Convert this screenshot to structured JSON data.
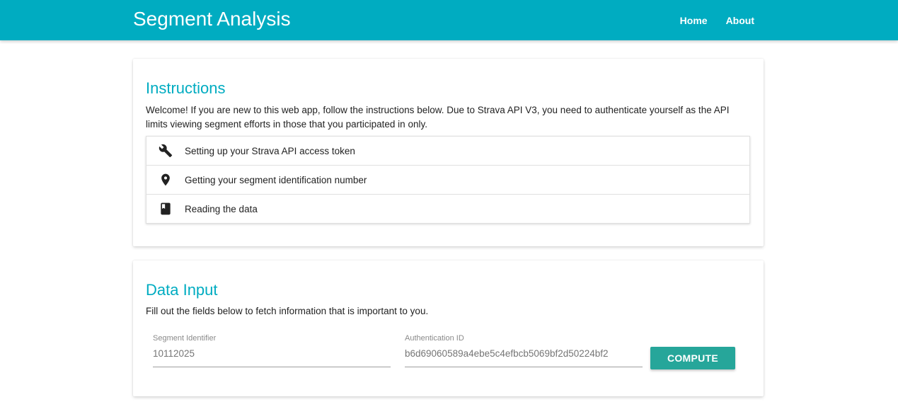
{
  "header": {
    "title": "Segment Analysis",
    "nav": [
      {
        "label": "Home"
      },
      {
        "label": "About"
      }
    ]
  },
  "instructions": {
    "title": "Instructions",
    "text": "Welcome! If you are new to this web app, follow the instructions below. Due to Strava API V3, you need to authenticate yourself as the API limits viewing segment efforts in those that you participated in only.",
    "items": [
      {
        "icon": "wrench-icon",
        "label": "Setting up your Strava API access token"
      },
      {
        "icon": "location-pin-icon",
        "label": "Getting your segment identification number"
      },
      {
        "icon": "book-icon",
        "label": "Reading the data"
      }
    ]
  },
  "data_input": {
    "title": "Data Input",
    "text": "Fill out the fields below to fetch information that is important to you.",
    "segment": {
      "label": "Segment Identifier",
      "placeholder": "10112025"
    },
    "auth": {
      "label": "Authentication ID",
      "placeholder": "b6d69060589a4ebe5c4efbcb5069bf2d50224bf2"
    },
    "compute_label": "COMPUTE"
  },
  "colors": {
    "primary": "#00acc1",
    "button": "#26a69a"
  }
}
